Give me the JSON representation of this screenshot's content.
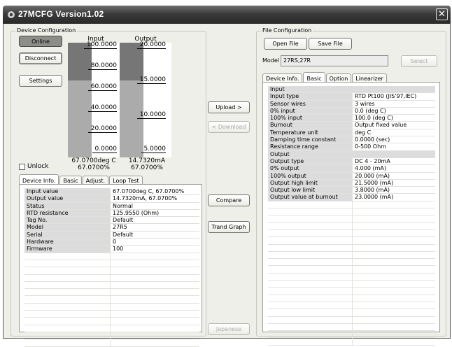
{
  "window": {
    "title": "27MCFG Version1.02",
    "close_glyph": "✕"
  },
  "device_config": {
    "label": "Device Configuration",
    "online_label": "Online",
    "disconnect_label": "Disconnect",
    "settings_label": "Settings",
    "unlock_label": "Unlock",
    "input_bar": {
      "header": "Input",
      "ticks": [
        "100.0000",
        "80.0000",
        "60.0000",
        "40.0000",
        "20.0000",
        "0.0000"
      ],
      "level_percent": 67.07,
      "value_text": "67.0700deg C",
      "percent_text": "67.0700%"
    },
    "output_bar": {
      "header": "Output",
      "ticks": [
        "20.0000",
        "15.0000",
        "10.0000",
        "5.0000"
      ],
      "level_percent": 67.07,
      "value_text": "14.7320mA",
      "percent_text": "67.0700%"
    },
    "tabs": [
      "Device Info.",
      "Basic",
      "Adjust.",
      "Loop Test"
    ],
    "info_rows": [
      {
        "label": "Input value",
        "value": "67.0700deg C, 67.0700%"
      },
      {
        "label": "Output value",
        "value": "14.7320mA, 67.0700%"
      },
      {
        "label": "Status",
        "value": "Normal"
      },
      {
        "label": "RTD resistance",
        "value": "125.9550 (Ohm)"
      },
      {
        "label": "Tag No.",
        "value": "Default"
      },
      {
        "label": "Model",
        "value": "27R5"
      },
      {
        "label": "Serial",
        "value": "Default"
      },
      {
        "label": "Hardware",
        "value": "0"
      },
      {
        "label": "Firmware",
        "value": "100"
      }
    ]
  },
  "middle": {
    "upload_label": "Upload >",
    "download_label": "< Download",
    "compare_label": "Compare",
    "trend_label": "Trand Graph",
    "japanese_label": "Japanese"
  },
  "file_config": {
    "label": "File Configuration",
    "open_label": "Open File",
    "save_label": "Save File",
    "model_label": "Model",
    "model_value": "27RS,27R",
    "select_label": "Select",
    "tabs": [
      "Device Info.",
      "Basic",
      "Option",
      "Linearizer"
    ],
    "rows": [
      {
        "section": "Input"
      },
      {
        "label": "Input type",
        "value": "RTD Pt100 (JIS'97,IEC)"
      },
      {
        "label": "Sensor wires",
        "value": "3 wires"
      },
      {
        "label": "0% input",
        "value": "0.0 (deg C)"
      },
      {
        "label": "100% input",
        "value": "100.0 (deg C)"
      },
      {
        "label": "Burnout",
        "value": "Output fixed value"
      },
      {
        "label": "Temperature unit",
        "value": "deg C"
      },
      {
        "label": "Damping time constant",
        "value": "0.0000 (sec)"
      },
      {
        "label": "Resistance range",
        "value": "0-500 Ohm"
      },
      {
        "section": "Output"
      },
      {
        "label": "Output type",
        "value": "DC 4 - 20mA"
      },
      {
        "label": "0% output",
        "value": "4.000 (mA)"
      },
      {
        "label": "100% output",
        "value": "20.000 (mA)"
      },
      {
        "label": "Output high limit",
        "value": "21.5000 (mA)"
      },
      {
        "label": "Output low limit",
        "value": "3.8000 (mA)"
      },
      {
        "label": "Output value at burnout",
        "value": "23.0000 (mA)"
      }
    ]
  },
  "colors": {
    "titlebar": "#3b3b3b",
    "bar_dark": "#7a7a7a",
    "bar_light": "#a8a8a8",
    "bar_mid": "#939393"
  }
}
